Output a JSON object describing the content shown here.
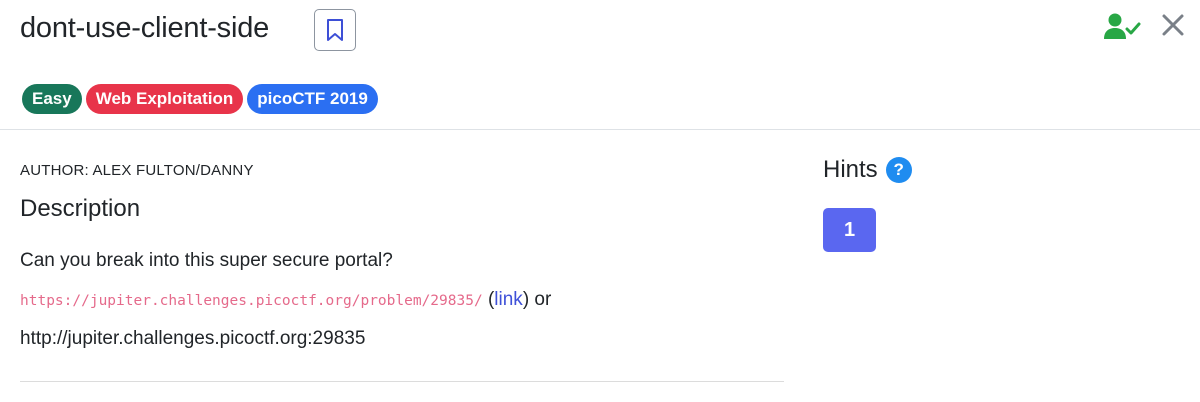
{
  "challenge": {
    "title": "dont-use-client-side",
    "tags": {
      "difficulty": "Easy",
      "category": "Web Exploitation",
      "event": "picoCTF 2019"
    }
  },
  "colors": {
    "difficulty_tag": "#18775a",
    "category_tag": "#e8344a",
    "event_tag": "#2b6ff2",
    "hint_button": "#5a67f0",
    "solved_icon": "#28a745",
    "code_text": "#e56a8b",
    "link": "#3f51d8"
  },
  "icons": {
    "bookmark": "bookmark-icon",
    "solved": "user-check-icon",
    "close": "close-icon",
    "help": "question-circle-icon"
  },
  "description": {
    "author": "AUTHOR: ALEX FULTON/DANNY",
    "heading": "Description",
    "text": "Can you break into this super secure portal?",
    "url_code": "https://jupiter.challenges.picoctf.org/problem/29835/",
    "paren_open": " (",
    "link_label": "link",
    "paren_close_or": ") or",
    "alt_url": "http://jupiter.challenges.picoctf.org:29835"
  },
  "hints": {
    "heading": "Hints",
    "help_glyph": "?",
    "buttons": [
      "1"
    ]
  }
}
